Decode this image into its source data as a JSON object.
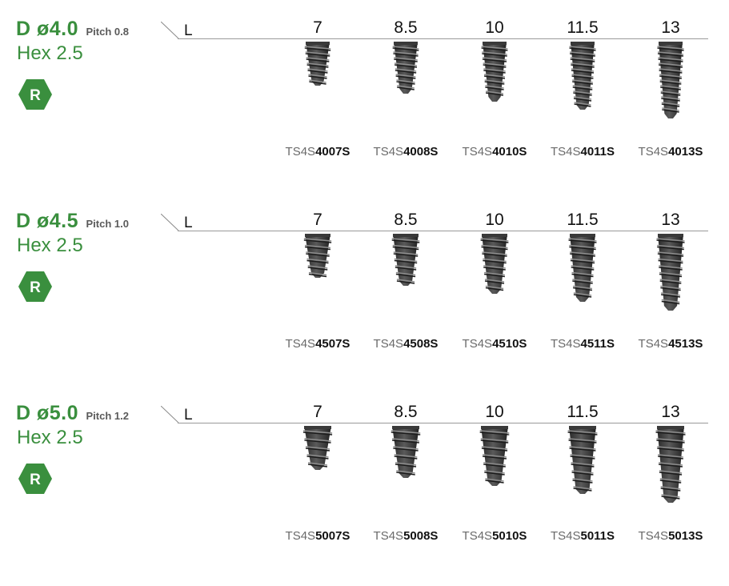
{
  "colors": {
    "brand_green": "#3a8f3e",
    "implant_dark": "#3a3a3a"
  },
  "sections": [
    {
      "diameter": "D ø4.0",
      "pitch": "Pitch 0.8",
      "hex": "Hex 2.5",
      "badge": "R",
      "length_label": "L",
      "lengths": [
        "7",
        "8.5",
        "10",
        "11.5",
        "13"
      ],
      "codes": [
        {
          "prefix": "TS4S",
          "suffix": "4007S"
        },
        {
          "prefix": "TS4S",
          "suffix": "4008S"
        },
        {
          "prefix": "TS4S",
          "suffix": "4010S"
        },
        {
          "prefix": "TS4S",
          "suffix": "4011S"
        },
        {
          "prefix": "TS4S",
          "suffix": "4013S"
        }
      ]
    },
    {
      "diameter": "D ø4.5",
      "pitch": "Pitch 1.0",
      "hex": "Hex 2.5",
      "badge": "R",
      "length_label": "L",
      "lengths": [
        "7",
        "8.5",
        "10",
        "11.5",
        "13"
      ],
      "codes": [
        {
          "prefix": "TS4S",
          "suffix": "4507S"
        },
        {
          "prefix": "TS4S",
          "suffix": "4508S"
        },
        {
          "prefix": "TS4S",
          "suffix": "4510S"
        },
        {
          "prefix": "TS4S",
          "suffix": "4511S"
        },
        {
          "prefix": "TS4S",
          "suffix": "4513S"
        }
      ]
    },
    {
      "diameter": "D ø5.0",
      "pitch": "Pitch 1.2",
      "hex": "Hex 2.5",
      "badge": "R",
      "length_label": "L",
      "lengths": [
        "7",
        "8.5",
        "10",
        "11.5",
        "13"
      ],
      "codes": [
        {
          "prefix": "TS4S",
          "suffix": "5007S"
        },
        {
          "prefix": "TS4S",
          "suffix": "5008S"
        },
        {
          "prefix": "TS4S",
          "suffix": "5010S"
        },
        {
          "prefix": "TS4S",
          "suffix": "5011S"
        },
        {
          "prefix": "TS4S",
          "suffix": "5013S"
        }
      ]
    }
  ]
}
